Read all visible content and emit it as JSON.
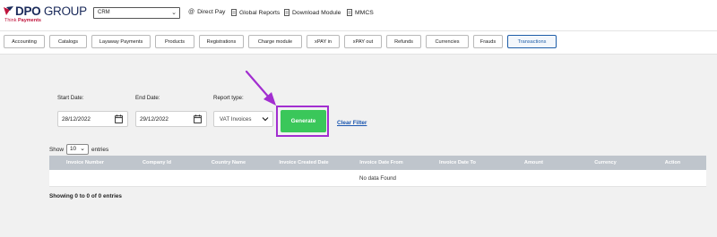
{
  "header": {
    "logo": {
      "brand_part1": "DPO",
      "brand_part2": "GROUP",
      "tagline_part1": "Think",
      "tagline_part2": "Payments"
    },
    "crm_select": {
      "value": "CRM"
    },
    "nav": [
      {
        "icon": "at-icon",
        "label": "Direct Pay"
      },
      {
        "icon": "document-icon",
        "label": "Global Reports"
      },
      {
        "icon": "document-icon",
        "label": "Download Module"
      },
      {
        "icon": "document-icon",
        "label": "MMCS"
      }
    ]
  },
  "tabs": [
    {
      "label": "Accounting"
    },
    {
      "label": "Catalogs"
    },
    {
      "label": "Layaway Payments"
    },
    {
      "label": "Products"
    },
    {
      "label": "Registrations"
    },
    {
      "label": "Charge module"
    },
    {
      "label": "xPAY in"
    },
    {
      "label": "xPAY out"
    },
    {
      "label": "Refunds"
    },
    {
      "label": "Currencies"
    },
    {
      "label": "Frauds"
    },
    {
      "label": "Transactions",
      "active": true
    }
  ],
  "form": {
    "start_date_label": "Start Date:",
    "start_date_value": "28/12/2022",
    "end_date_label": "End Date:",
    "end_date_value": "29/12/2022",
    "report_type_label": "Report type:",
    "report_type_value": "VAT Invoices",
    "generate_label": "Generate",
    "clear_filter_label": "Clear Filter"
  },
  "table": {
    "show_label": "Show",
    "page_size": "10",
    "entries_label": "entries",
    "columns": [
      "Invoice Number",
      "Company Id",
      "Country Name",
      "Invoice Created Date",
      "Invoice Date From",
      "Invoice Date To",
      "Amount",
      "Currency",
      "Action"
    ],
    "empty_message": "No data Found",
    "showing_text": "Showing 0 to 0 of 0 entries"
  },
  "colors": {
    "highlight": "#a22ed0",
    "generate_button": "#3ac75a",
    "active_tab": "#1f5ea8",
    "link": "#1a56b0"
  }
}
